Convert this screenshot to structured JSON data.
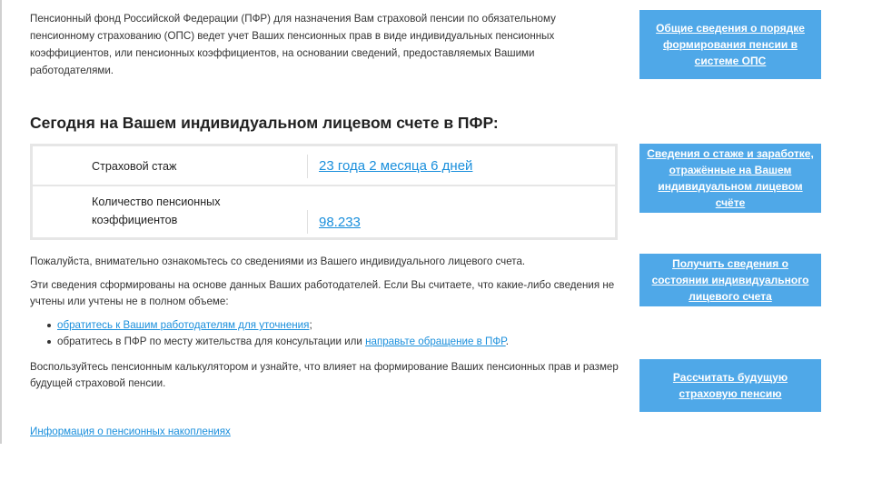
{
  "intro": "Пенсионный фонд Российской Федерации (ПФР) для назначения Вам страховой пенсии по обязательному пенсионному страхованию (ОПС) ведет учет Ваших пенсионных прав в виде индивидуальных пенсионных коэффициентов, или пенсионных коэффициентов, на основании сведений, предоставляемых Вашими работодателями.",
  "heading": "Сегодня на Вашем индивидуальном лицевом счете в ПФР:",
  "account": {
    "rows": [
      {
        "label": "Страховой стаж",
        "value": "23 года 2 месяца 6 дней"
      },
      {
        "label": "Количество пенсионных коэффициентов",
        "value": "98.233"
      }
    ]
  },
  "p1": "Пожалуйста, внимательно ознакомьтесь со сведениями из Вашего индивидуального лицевого счета.",
  "p2": "Эти сведения сформированы на основе данных Ваших работодателей. Если Вы считаете, что какие-либо сведения не учтены или учтены не в полном объеме:",
  "bullets": {
    "b1_link": "обратитесь к Вашим работодателям для уточнения",
    "b1_after": ";",
    "b2_before": "обратитесь в ПФР по месту жительства для консультации или ",
    "b2_link": "направьте обращение в ПФР",
    "b2_after": "."
  },
  "p3": "Воспользуйтесь пенсионным калькулятором и узнайте, что влияет на формирование Ваших пенсионных прав и размер будущей страховой пенсии.",
  "bottom_link": "Информация о пенсионных накоплениях",
  "sidebar": {
    "buttons": [
      "Общие сведения о порядке формирования пенсии в системе ОПС",
      "Сведения о стаже и заработке, отражённые на Вашем индивидуальном лицевом счёте",
      "Получить сведения о состоянии индивидуального лицевого счета",
      "Рассчитать будущую страховую пенсию"
    ]
  },
  "colors": {
    "accent": "#1a8fdc",
    "button_bg": "#4fa8e8",
    "table_border": "#e6e6e6"
  }
}
